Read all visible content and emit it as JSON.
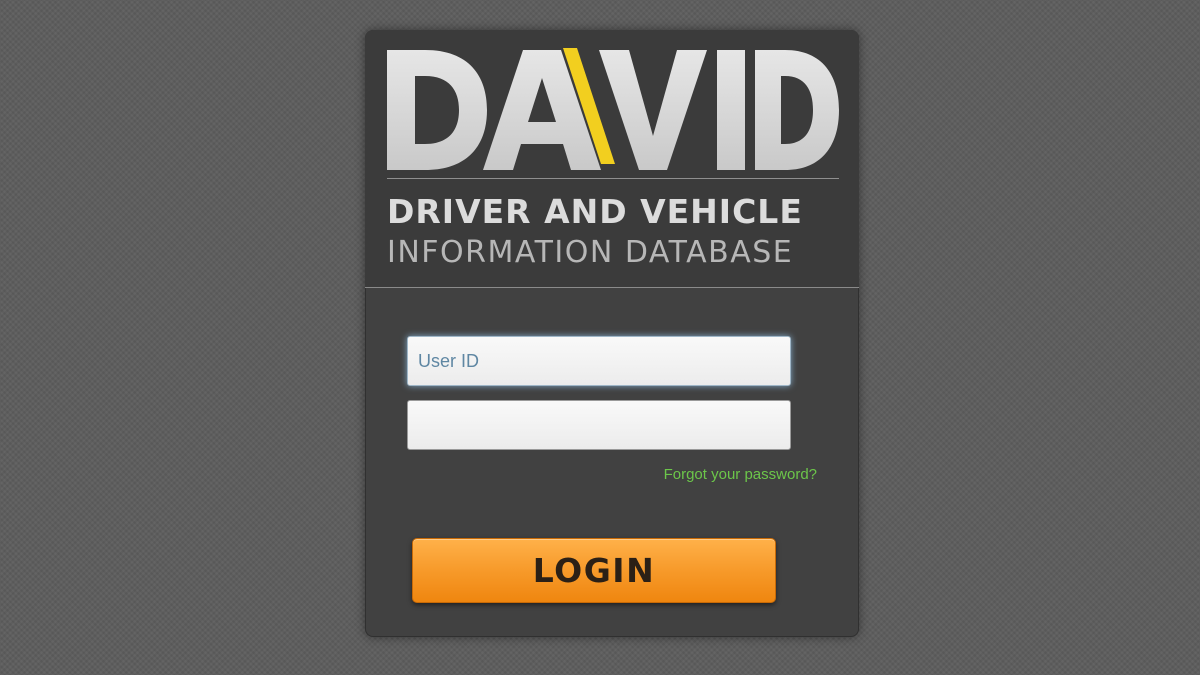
{
  "brand": {
    "logo_text": "DAVID",
    "tagline_line1": "DRIVER AND VEHICLE",
    "tagline_line2": "INFORMATION DATABASE"
  },
  "login_form": {
    "user_id_placeholder": "User ID",
    "password_placeholder": "",
    "forgot_password_label": "Forgot your password?",
    "login_button_label": "LOGIN"
  },
  "colors": {
    "page_background": "#5d5d5d",
    "panel_background": "#414141",
    "logo_letters": "#dcdcdc",
    "road_stripe": "#f2cf1f",
    "link_green": "#6cc64a",
    "button_orange": "#f79a2a"
  }
}
